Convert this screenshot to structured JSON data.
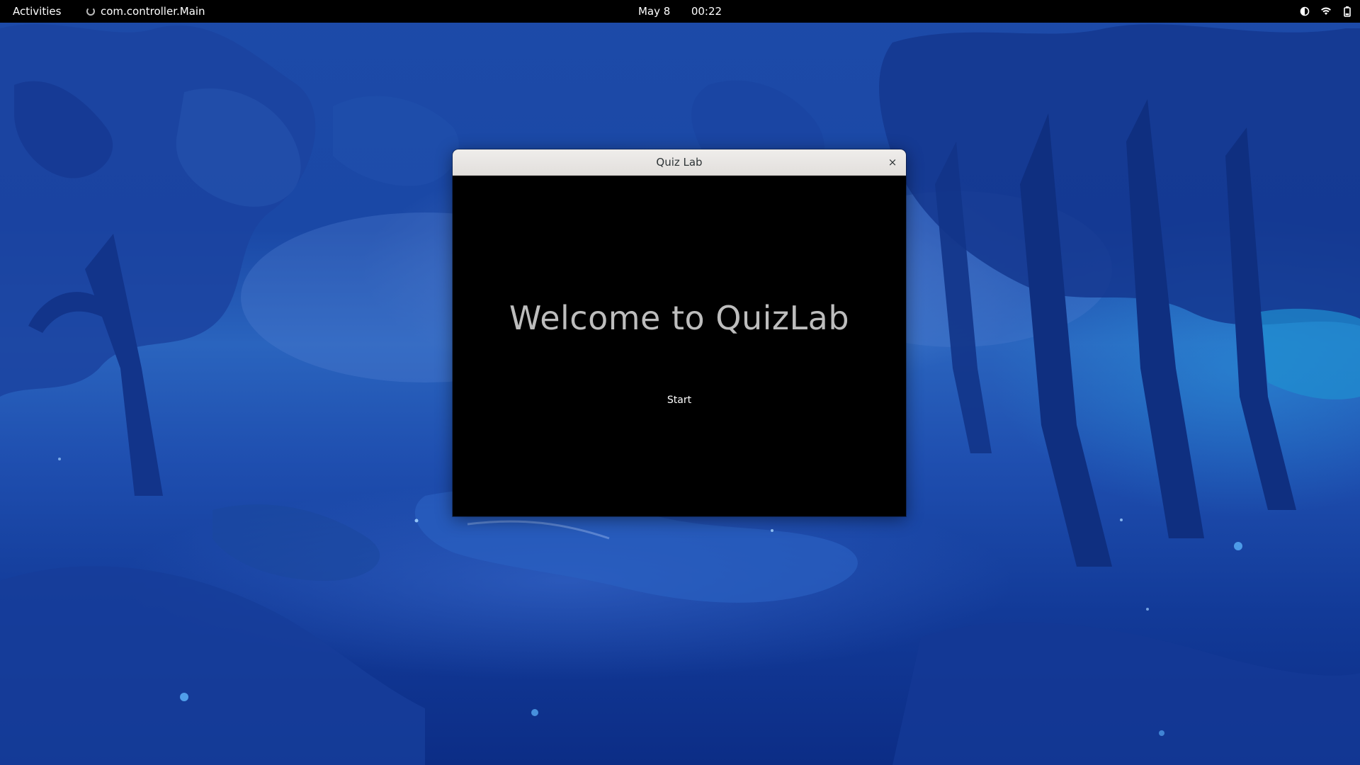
{
  "topbar": {
    "activities_label": "Activities",
    "app_name": "com.controller.Main",
    "date": "May 8",
    "time": "00:22",
    "status_icons": [
      "night-light-icon",
      "wifi-icon",
      "battery-icon"
    ]
  },
  "window": {
    "title": "Quiz Lab",
    "close_glyph": "×",
    "welcome_text": "Welcome to QuizLab",
    "start_label": "Start"
  },
  "colors": {
    "topbar_bg": "#000000",
    "window_bg": "#000000",
    "welcome_text": "#bdbdbd",
    "wallpaper_main": "#1d4aa8"
  }
}
